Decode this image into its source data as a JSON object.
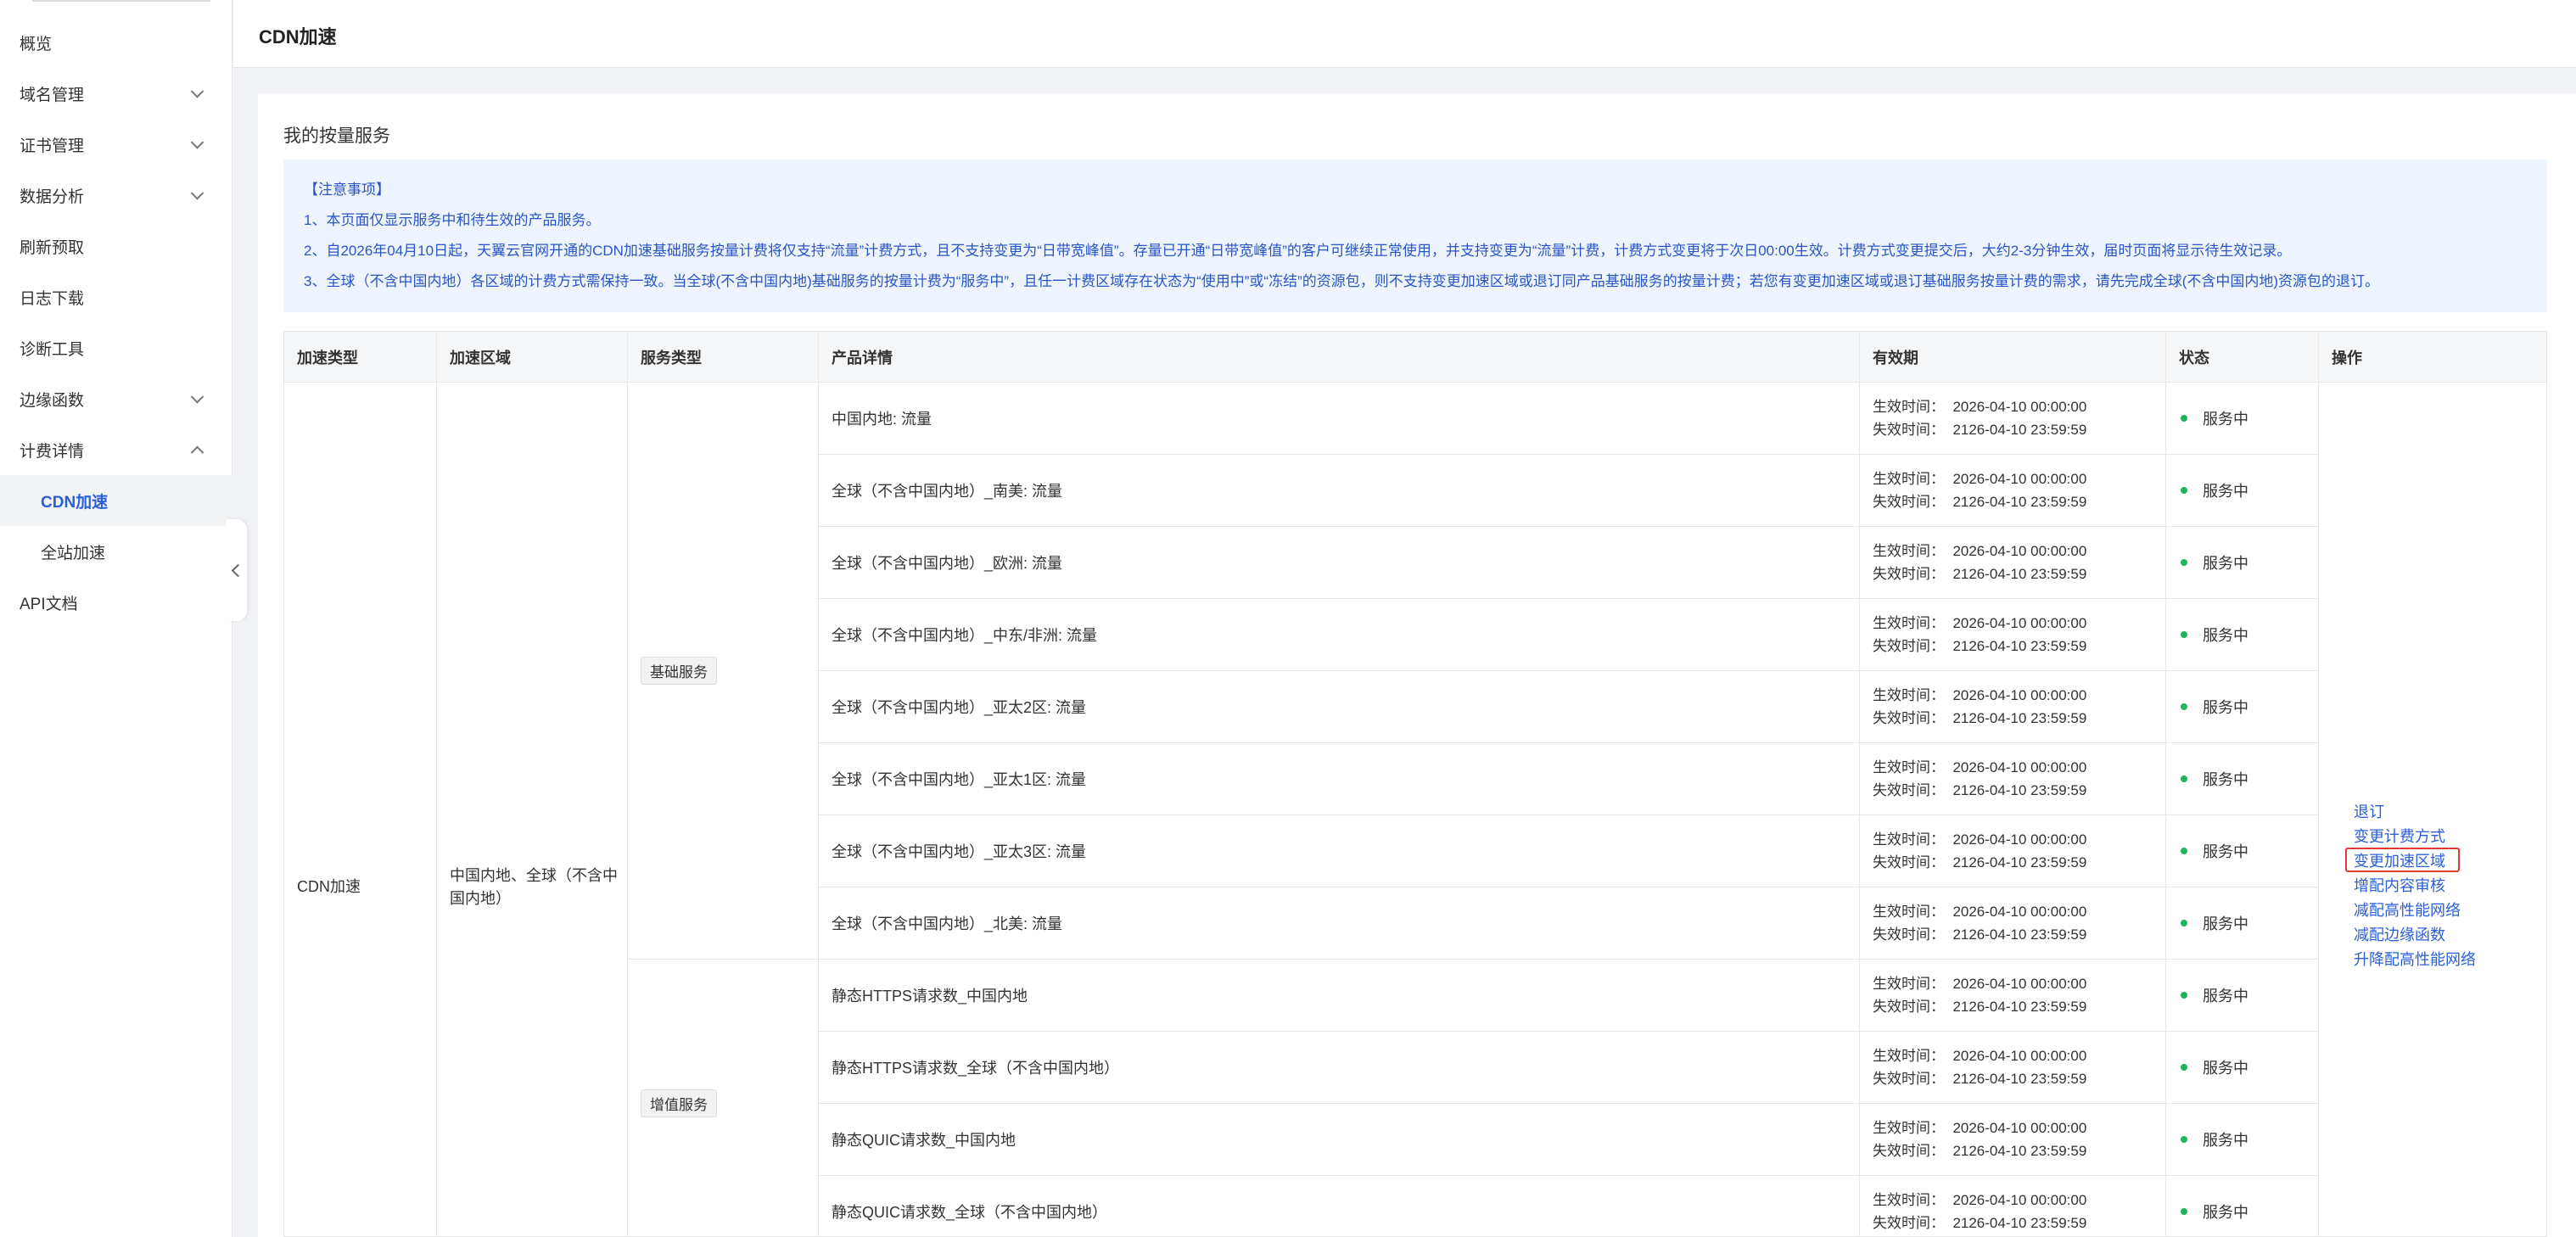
{
  "sidebar": {
    "items": [
      {
        "label": "概览",
        "chevron": "",
        "sub": false,
        "active": false
      },
      {
        "label": "域名管理",
        "chevron": "down",
        "sub": false,
        "active": false
      },
      {
        "label": "证书管理",
        "chevron": "down",
        "sub": false,
        "active": false
      },
      {
        "label": "数据分析",
        "chevron": "down",
        "sub": false,
        "active": false
      },
      {
        "label": "刷新预取",
        "chevron": "",
        "sub": false,
        "active": false
      },
      {
        "label": "日志下载",
        "chevron": "",
        "sub": false,
        "active": false
      },
      {
        "label": "诊断工具",
        "chevron": "",
        "sub": false,
        "active": false
      },
      {
        "label": "边缘函数",
        "chevron": "down",
        "sub": false,
        "active": false
      },
      {
        "label": "计费详情",
        "chevron": "up",
        "sub": false,
        "active": false
      },
      {
        "label": "CDN加速",
        "chevron": "",
        "sub": true,
        "active": true
      },
      {
        "label": "全站加速",
        "chevron": "",
        "sub": true,
        "active": false
      },
      {
        "label": "API文档",
        "chevron": "",
        "sub": false,
        "active": false
      }
    ]
  },
  "header": {
    "title": "CDN加速"
  },
  "main": {
    "section_title": "我的按量服务",
    "notice": [
      "【注意事项】",
      "1、本页面仅显示服务中和待生效的产品服务。",
      "2、自2026年04月10日起，天翼云官网开通的CDN加速基础服务按量计费将仅支持“流量”计费方式，且不支持变更为“日带宽峰值”。存量已开通“日带宽峰值”的客户可继续正常使用，并支持变更为“流量”计费，计费方式变更将于次日00:00生效。计费方式变更提交后，大约2-3分钟生效，届时页面将显示待生效记录。",
      "3、全球（不含中国内地）各区域的计费方式需保持一致。当全球(不含中国内地)基础服务的按量计费为“服务中”，且任一计费区域存在状态为“使用中”或“冻结”的资源包，则不支持变更加速区域或退订同产品基础服务的按量计费；若您有变更加速区域或退订基础服务按量计费的需求，请先完成全球(不含中国内地)资源包的退订。"
    ]
  },
  "table": {
    "headers": [
      "加速类型",
      "加速区域",
      "服务类型",
      "产品详情",
      "有效期",
      "状态",
      "操作"
    ],
    "acceleration_type": "CDN加速",
    "acceleration_region": "中国内地、全球（不含中国内地）",
    "service_types": [
      {
        "label": "基础服务",
        "row_count": 8
      },
      {
        "label": "增值服务",
        "row_count": 4
      }
    ],
    "rows": [
      {
        "product": "中国内地: 流量",
        "start": "生效时间：  2026-04-10 00:00:00",
        "end": "失效时间：  2126-04-10 23:59:59",
        "status": "服务中"
      },
      {
        "product": "全球（不含中国内地）_南美: 流量",
        "start": "生效时间：  2026-04-10 00:00:00",
        "end": "失效时间：  2126-04-10 23:59:59",
        "status": "服务中"
      },
      {
        "product": "全球（不含中国内地）_欧洲: 流量",
        "start": "生效时间：  2026-04-10 00:00:00",
        "end": "失效时间：  2126-04-10 23:59:59",
        "status": "服务中"
      },
      {
        "product": "全球（不含中国内地）_中东/非洲: 流量",
        "start": "生效时间：  2026-04-10 00:00:00",
        "end": "失效时间：  2126-04-10 23:59:59",
        "status": "服务中"
      },
      {
        "product": "全球（不含中国内地）_亚太2区: 流量",
        "start": "生效时间：  2026-04-10 00:00:00",
        "end": "失效时间：  2126-04-10 23:59:59",
        "status": "服务中"
      },
      {
        "product": "全球（不含中国内地）_亚太1区: 流量",
        "start": "生效时间：  2026-04-10 00:00:00",
        "end": "失效时间：  2126-04-10 23:59:59",
        "status": "服务中"
      },
      {
        "product": "全球（不含中国内地）_亚太3区: 流量",
        "start": "生效时间：  2026-04-10 00:00:00",
        "end": "失效时间：  2126-04-10 23:59:59",
        "status": "服务中"
      },
      {
        "product": "全球（不含中国内地）_北美: 流量",
        "start": "生效时间：  2026-04-10 00:00:00",
        "end": "失效时间：  2126-04-10 23:59:59",
        "status": "服务中"
      },
      {
        "product": "静态HTTPS请求数_中国内地",
        "start": "生效时间：  2026-04-10 00:00:00",
        "end": "失效时间：  2126-04-10 23:59:59",
        "status": "服务中"
      },
      {
        "product": "静态HTTPS请求数_全球（不含中国内地）",
        "start": "生效时间：  2026-04-10 00:00:00",
        "end": "失效时间：  2126-04-10 23:59:59",
        "status": "服务中"
      },
      {
        "product": "静态QUIC请求数_中国内地",
        "start": "生效时间：  2026-04-10 00:00:00",
        "end": "失效时间：  2126-04-10 23:59:59",
        "status": "服务中"
      },
      {
        "product": "静态QUIC请求数_全球（不含中国内地）",
        "start": "生效时间：  2026-04-10 00:00:00",
        "end": "失效时间：  2126-04-10 23:59:59",
        "status": "服务中"
      }
    ],
    "operations": [
      {
        "label": "退订",
        "highlighted": false
      },
      {
        "label": "变更计费方式",
        "highlighted": false
      },
      {
        "label": "变更加速区域",
        "highlighted": true
      },
      {
        "label": "增配内容审核",
        "highlighted": false
      },
      {
        "label": "减配高性能网络",
        "highlighted": false
      },
      {
        "label": "减配边缘函数",
        "highlighted": false
      },
      {
        "label": "升降配高性能网络",
        "highlighted": false
      }
    ]
  },
  "colors": {
    "accent": "#2a5fd8",
    "status_dot": "#1fb55a",
    "notice_bg": "#eef4fd",
    "highlight_border": "#e03c31"
  },
  "icons": {
    "chevron_down": "chevron-down-icon",
    "chevron_up": "chevron-up-icon",
    "collapse": "chevron-left-icon",
    "status": "status-dot-icon"
  }
}
